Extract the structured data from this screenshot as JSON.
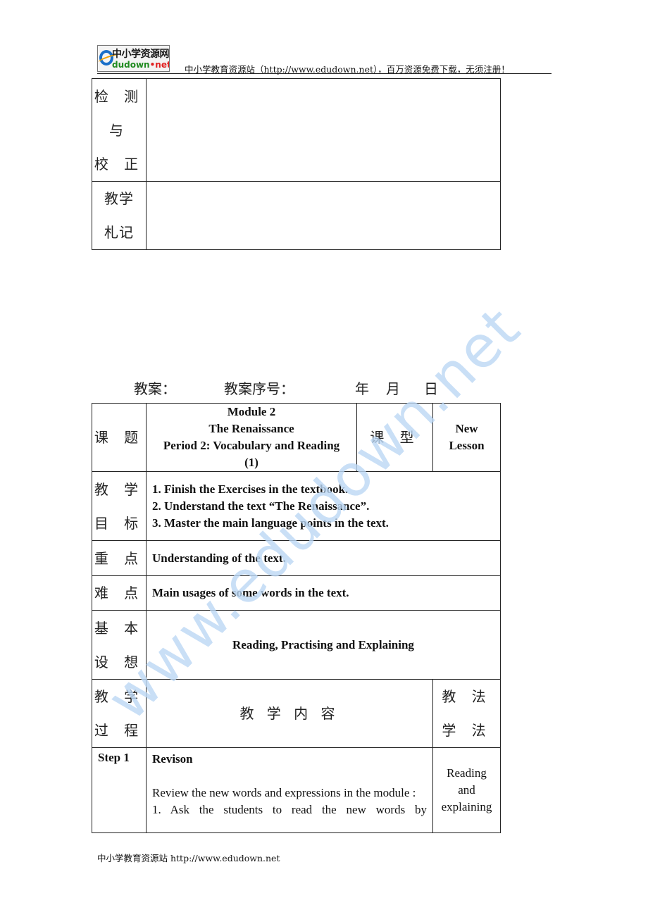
{
  "header": {
    "logo_cn": "中小学资源网",
    "logo_en_main": "dudown",
    "logo_en_dot": "•",
    "logo_en_tld": "net",
    "text": "中小学教育资源站（http://www.edudown.net），百万资源免费下载，无须注册！"
  },
  "top_table": {
    "rows": [
      {
        "label_lines": [
          "检 测",
          "与",
          "校 正"
        ],
        "content": ""
      },
      {
        "label_lines": [
          "教学",
          "札记"
        ],
        "content": ""
      }
    ]
  },
  "title_line": {
    "plan": "教案：",
    "plan_no": "教案序号：",
    "year": "年",
    "month": "月",
    "day": "日"
  },
  "lesson_table": {
    "topic_label": "课 题",
    "topic_lines": [
      "Module 2",
      "The Renaissance",
      "Period 2: Vocabulary and Reading",
      "(1)"
    ],
    "type_label": "课 型",
    "type_lines": [
      "New",
      "Lesson"
    ],
    "goals_label": [
      "教 学",
      "目 标"
    ],
    "goals": [
      "1. Finish the Exercises in the textbook.",
      "2. Understand the text “The Renaissance”.",
      "3. Master the main language points in the text."
    ],
    "key_label": "重 点",
    "key": "Understanding of the text.",
    "difficult_label": "难 点",
    "difficult": "Main usages of some words in the text.",
    "idea_label": [
      "基 本",
      "设 想"
    ],
    "idea": "Reading, Practising and Explaining",
    "process_label": [
      "教 学",
      "过 程"
    ],
    "content_header": "教 学 内 容",
    "method_label": [
      "教 法",
      "学 法"
    ],
    "step1": {
      "step": "Step 1",
      "title": "Revison",
      "text1": "Review the new words and expressions in the module :",
      "text2": "1. Ask the students to read the new words by",
      "method_lines": [
        "Reading",
        "and",
        "explaining"
      ]
    }
  },
  "footer": {
    "text": "中小学教育资源站  http://www.edudown.net"
  },
  "watermark": "www.edudown.net"
}
